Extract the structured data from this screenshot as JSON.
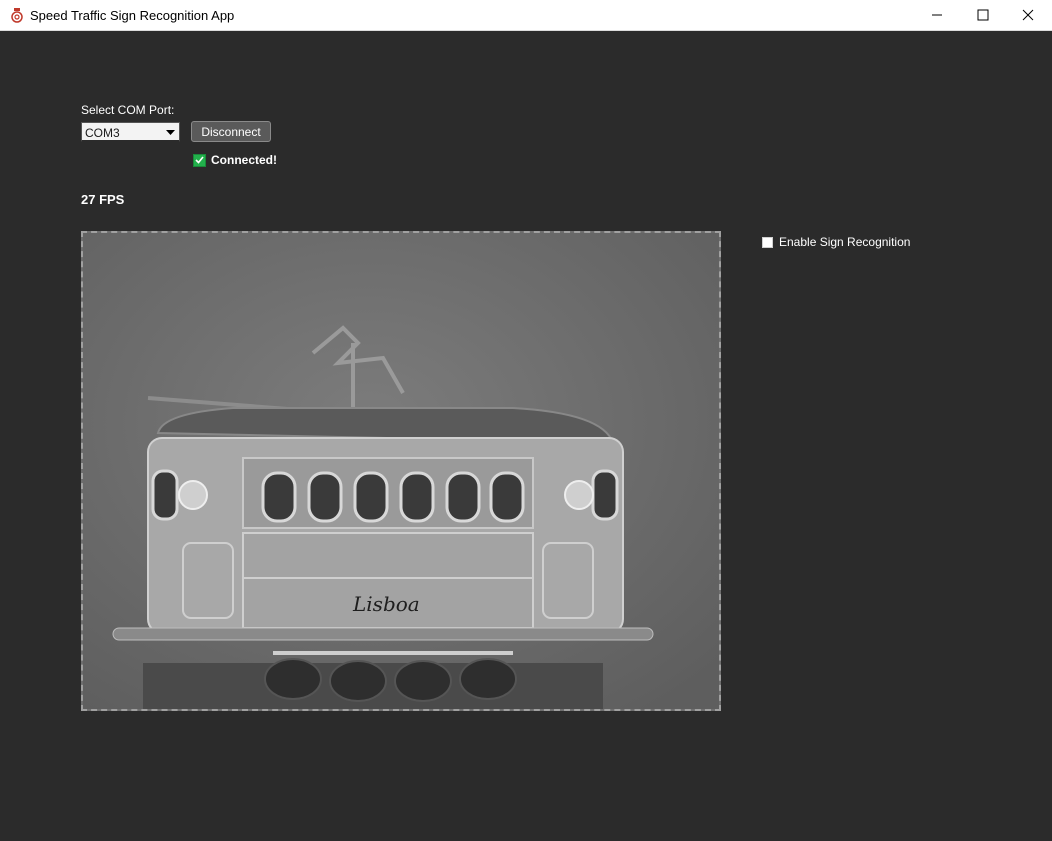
{
  "window": {
    "title": "Speed Traffic Sign Recognition App",
    "icon": "app-icon",
    "controls": [
      "minimize-icon",
      "maximize-icon",
      "close-icon"
    ]
  },
  "connection": {
    "port_label": "Select COM Port:",
    "port_value": "COM3",
    "disconnect_label": "Disconnect",
    "status_text": "Connected!",
    "status_icon": "checkmark-icon",
    "status_color": "#22b14c"
  },
  "stats": {
    "fps_text": "27 FPS"
  },
  "recognition": {
    "enable_label": "Enable Sign Recognition",
    "enabled": false
  },
  "camera": {
    "content": "grayscale webcam view of a model tram",
    "sign_text": "Lisboa"
  },
  "colors": {
    "background": "#2b2b2b",
    "titlebar": "#ffffff",
    "status_green": "#22b14c"
  }
}
